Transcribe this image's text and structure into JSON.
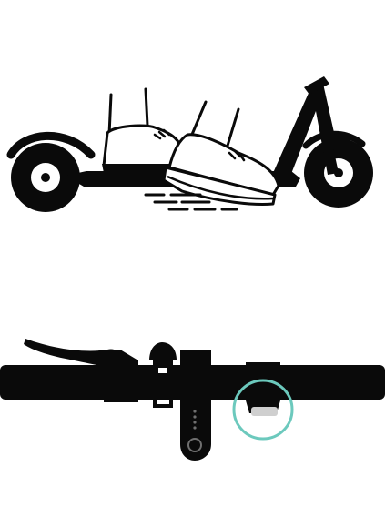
{
  "figure": {
    "panels": [
      {
        "id": "kick-start",
        "subject": "scooter-with-feet-pushing-off",
        "icons": [
          "scooter-icon",
          "shoe-icon",
          "motion-lines-icon"
        ]
      },
      {
        "id": "handlebar-controls",
        "subject": "handlebar-with-throttle-highlighted",
        "icons": [
          "handlebar-icon",
          "brake-lever-icon",
          "bell-icon",
          "display-unit-icon",
          "power-button-icon",
          "throttle-icon"
        ]
      }
    ],
    "colors": {
      "ink": "#0a0a0a",
      "background": "#ffffff",
      "highlight": "#6cc9bd",
      "throttle_face": "#cfcfcf"
    },
    "display_unit": {
      "battery_indicator_dots": 4
    }
  }
}
